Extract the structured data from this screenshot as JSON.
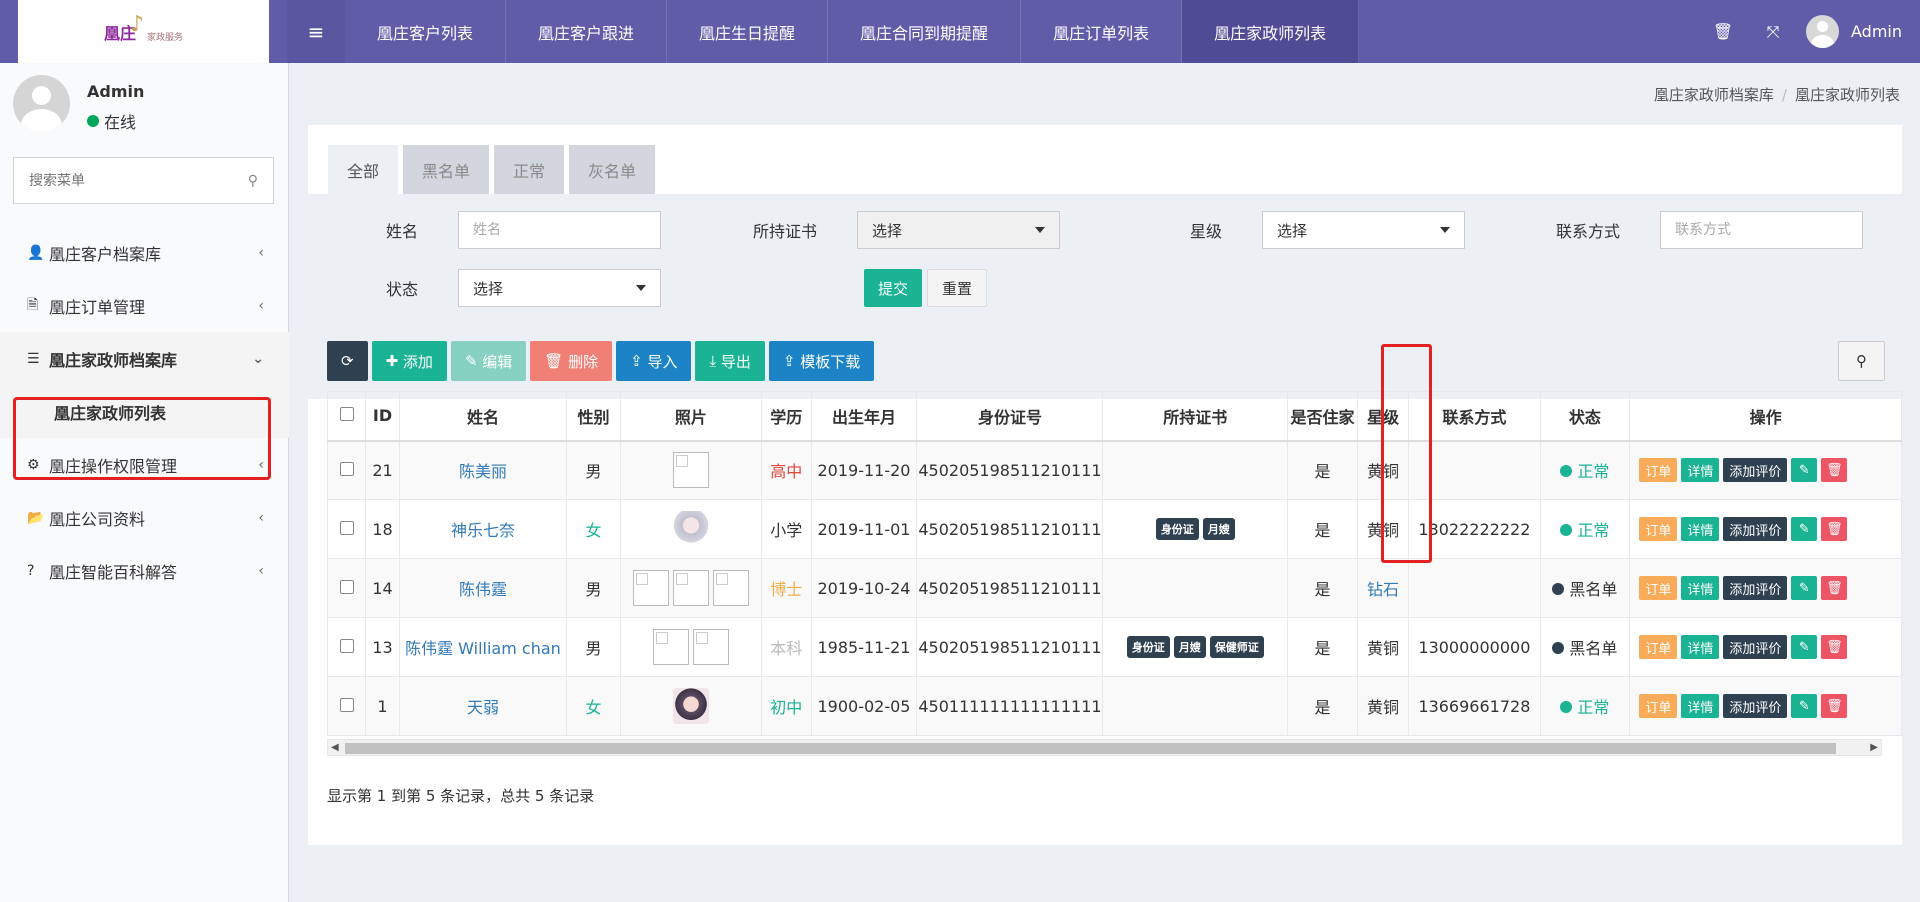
{
  "app": {
    "logo_text": "凰庄",
    "logo_sub": "家政服务",
    "menu_icon": "hamburger-icon"
  },
  "topnav": {
    "tabs": [
      {
        "label": "凰庄客户列表"
      },
      {
        "label": "凰庄客户跟进"
      },
      {
        "label": "凰庄生日提醒"
      },
      {
        "label": "凰庄合同到期提醒"
      },
      {
        "label": "凰庄订单列表"
      },
      {
        "label": "凰庄家政师列表"
      }
    ],
    "user_name": "Admin"
  },
  "sidebar": {
    "user": {
      "name": "Admin",
      "status": "在线"
    },
    "search_placeholder": "搜索菜单",
    "items": [
      {
        "label": "凰庄客户档案库",
        "icon": "user-icon"
      },
      {
        "label": "凰庄订单管理",
        "icon": "file-icon"
      },
      {
        "label": "凰庄家政师档案库",
        "icon": "list-icon",
        "sub": "凰庄家政师列表"
      },
      {
        "label": "凰庄操作权限管理",
        "icon": "cogs-icon"
      },
      {
        "label": "凰庄公司资料",
        "icon": "folder-open-icon"
      },
      {
        "label": "凰庄智能百科解答",
        "icon": "question-circle-icon"
      }
    ]
  },
  "breadcrumb": {
    "parent": "凰庄家政师档案库",
    "current": "凰庄家政师列表"
  },
  "filter_tabs": [
    {
      "label": "全部"
    },
    {
      "label": "黑名单"
    },
    {
      "label": "正常"
    },
    {
      "label": "灰名单"
    }
  ],
  "filters": {
    "name_label": "姓名",
    "name_placeholder": "姓名",
    "cert_label": "所持证书",
    "cert_value": "选择",
    "star_label": "星级",
    "star_value": "选择",
    "contact_label": "联系方式",
    "contact_placeholder": "联系方式",
    "status_label": "状态",
    "status_value": "选择",
    "submit": "提交",
    "reset": "重置"
  },
  "toolbar": {
    "add": "添加",
    "edit": "编辑",
    "delete": "删除",
    "import": "导入",
    "export": "导出",
    "template": "模板下载"
  },
  "table": {
    "headers": [
      "ID",
      "姓名",
      "性别",
      "照片",
      "学历",
      "出生年月",
      "身份证号",
      "所持证书",
      "是否住家",
      "星级",
      "联系方式",
      "状态",
      "操作"
    ],
    "rows": [
      {
        "id": "21",
        "name": "陈美丽",
        "sex": "男",
        "edu": "高中",
        "birth": "2019-11-20",
        "idno": "450205198511210111",
        "certs": [],
        "live": "是",
        "star": "黄铜",
        "phone": "",
        "status": "正常"
      },
      {
        "id": "18",
        "name": "神乐七奈",
        "sex": "女",
        "edu": "小学",
        "birth": "2019-11-01",
        "idno": "450205198511210111",
        "certs": [
          "身份证",
          "月嫂"
        ],
        "live": "是",
        "star": "黄铜",
        "phone": "13022222222",
        "status": "正常"
      },
      {
        "id": "14",
        "name": "陈伟霆",
        "sex": "男",
        "edu": "博士",
        "birth": "2019-10-24",
        "idno": "450205198511210111",
        "certs": [],
        "live": "是",
        "star": "钻石",
        "phone": "",
        "status": "黑名单"
      },
      {
        "id": "13",
        "name": "陈伟霆 William chan",
        "sex": "男",
        "edu": "本科",
        "birth": "1985-11-21",
        "idno": "450205198511210111",
        "certs": [
          "身份证",
          "月嫂",
          "保健师证"
        ],
        "live": "是",
        "star": "黄铜",
        "phone": "13000000000",
        "status": "黑名单"
      },
      {
        "id": "1",
        "name": "天弱",
        "sex": "女",
        "edu": "初中",
        "birth": "1900-02-05",
        "idno": "450111111111111111",
        "certs": [],
        "live": "是",
        "star": "黄铜",
        "phone": "13669661728",
        "status": "正常"
      }
    ],
    "ops": {
      "order": "订单",
      "detail": "详情",
      "rate": "添加评价"
    }
  },
  "pagination": {
    "info": "显示第 1 到第 5 条记录，总共 5 条记录"
  },
  "colors": {
    "header": "#605ca8",
    "primary": "#1ab394",
    "danger": "#ed5565",
    "warning": "#f8ac59",
    "dark": "#2f4050",
    "highlight": "#e52020"
  }
}
